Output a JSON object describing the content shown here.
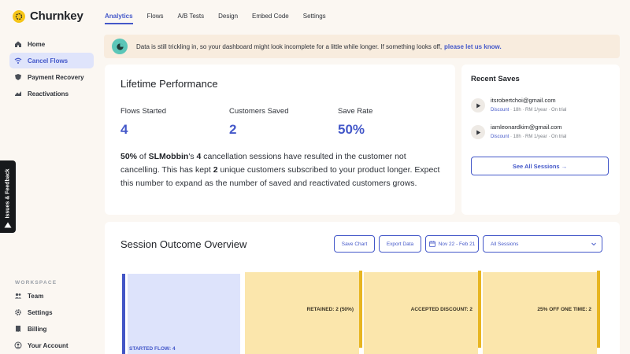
{
  "app": {
    "name": "Churnkey"
  },
  "sidebar": {
    "items": [
      {
        "label": "Home",
        "icon": "home-icon",
        "active": false
      },
      {
        "label": "Cancel Flows",
        "icon": "wifi-icon",
        "active": true
      },
      {
        "label": "Payment Recovery",
        "icon": "shield-icon",
        "active": false
      },
      {
        "label": "Reactivations",
        "icon": "chart-icon",
        "active": false
      }
    ],
    "workspace_label": "WORKSPACE",
    "workspace_items": [
      {
        "label": "Team",
        "icon": "team-icon"
      },
      {
        "label": "Settings",
        "icon": "gear-icon"
      },
      {
        "label": "Billing",
        "icon": "billing-icon"
      },
      {
        "label": "Your Account",
        "icon": "account-icon"
      }
    ]
  },
  "feedback": {
    "label": "Issues & Feedback"
  },
  "tabs": [
    {
      "label": "Analytics",
      "active": true
    },
    {
      "label": "Flows",
      "active": false
    },
    {
      "label": "A/B Tests",
      "active": false
    },
    {
      "label": "Design",
      "active": false
    },
    {
      "label": "Embed Code",
      "active": false
    },
    {
      "label": "Settings",
      "active": false
    }
  ],
  "alert": {
    "text": "Data is still trickling in, so your dashboard might look incomplete for a little while longer. If something looks off,",
    "link": "please let us know."
  },
  "lifetime": {
    "title": "Lifetime Performance",
    "stats": [
      {
        "label": "Flows Started",
        "value": "4"
      },
      {
        "label": "Customers Saved",
        "value": "2"
      },
      {
        "label": "Save Rate",
        "value": "50%"
      }
    ],
    "desc": {
      "rate": "50%",
      "t1": " of ",
      "company": "SLMobbin",
      "t2": "'s ",
      "sessions": "4",
      "t3": " cancellation sessions have resulted in the customer not cancelling. This has kept ",
      "kept": "2",
      "t4": " unique customers subscribed to your product longer. Expect this number to expand as the number of saved and reactivated customers grows."
    }
  },
  "saves": {
    "title": "Recent Saves",
    "items": [
      {
        "email": "itsrobertchoi@gmail.com",
        "discount": "Discount",
        "meta": " · 18h · RM 1/year · On trial"
      },
      {
        "email": "iamleonardkim@gmail.com",
        "discount": "Discount",
        "meta": " · 18h · RM 1/year · On trial"
      }
    ],
    "see_all": "See All Sessions →"
  },
  "overview": {
    "title": "Session Outcome Overview",
    "save_chart": "Save Chart",
    "export_data": "Export Data",
    "date_range": "Nov 22 - Feb 21",
    "sessions_select": "All Sessions",
    "nodes": {
      "started": "STARTED FLOW: 4",
      "retained": "RETAINED: 2 (50%)",
      "accepted": "ACCEPTED DISCOUNT: 2",
      "offer": "25% OFF ONE TIME: 2"
    }
  },
  "colors": {
    "accent": "#4458c9",
    "sidebar_active_bg": "#dfe4fb",
    "alert_bg": "#f8ecde",
    "flow_start": "#dde3fb",
    "flow_node": "#fbe6ac",
    "flow_bar": "#e7b521"
  }
}
